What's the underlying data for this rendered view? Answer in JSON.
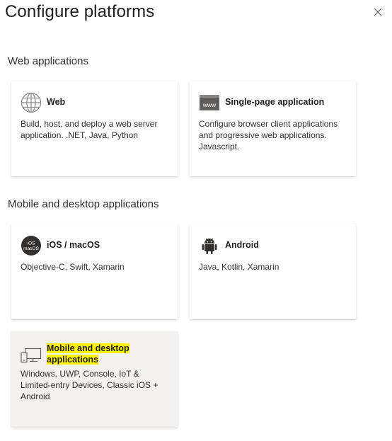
{
  "panel": {
    "title": "Configure platforms"
  },
  "sections": [
    {
      "label": "Web applications"
    },
    {
      "label": "Mobile and desktop applications"
    }
  ],
  "cards": {
    "web": {
      "name": "Web",
      "icon": "globe-icon",
      "description": "Build, host, and deploy a web server application. .NET, Java, Python"
    },
    "spa": {
      "name": "Single-page application",
      "icon": "www-icon",
      "icon_text": "www",
      "description": "Configure browser client applications and progressive web applications. Javascript."
    },
    "ios": {
      "name": "iOS / macOS",
      "icon": "ios-macos-icon",
      "icon_text_top": "iOS",
      "icon_text_bottom": "macOS",
      "description": "Objective-C, Swift, Xamarin"
    },
    "android": {
      "name": "Android",
      "icon": "android-icon",
      "description": "Java, Kotlin, Xamarin"
    },
    "desktop": {
      "name": "Mobile and desktop applications",
      "icon": "desktop-mobile-icon",
      "description": "Windows, UWP, Console, IoT & Limited-entry Devices, Classic iOS + Android"
    }
  },
  "colors": {
    "highlight": "#fff200",
    "selected_card_bg": "#f3f2f1"
  }
}
